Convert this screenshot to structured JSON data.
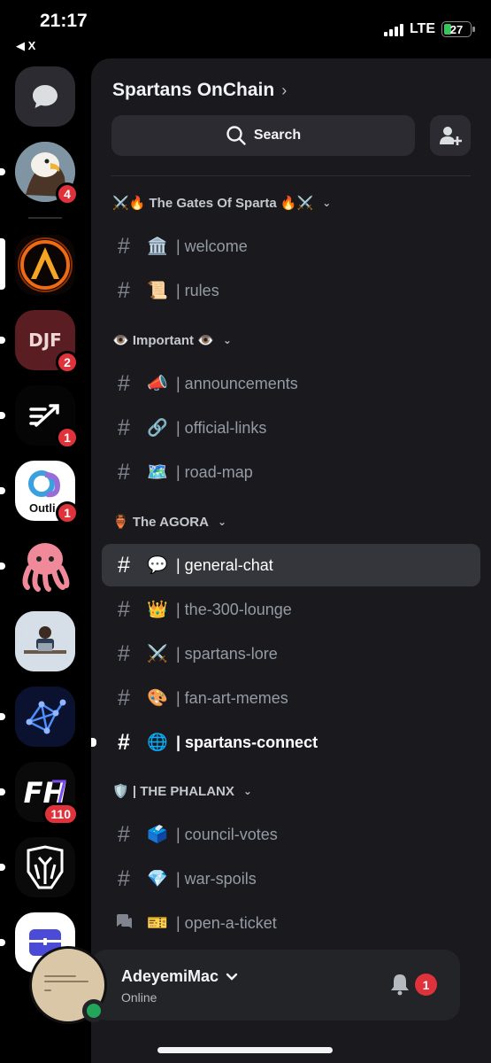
{
  "status_bar": {
    "time": "21:17",
    "back_label": "◀ X",
    "network": "LTE",
    "battery": "27",
    "battery_level": 0.27
  },
  "rail": {
    "servers": [
      {
        "name": "direct-messages",
        "badge": ""
      },
      {
        "name": "eagle-server",
        "badge": "4"
      },
      {
        "name": "fire-logo-server",
        "badge": ""
      },
      {
        "name": "djf-server",
        "badge": "2"
      },
      {
        "name": "arrow-logo-server",
        "badge": "1"
      },
      {
        "name": "outlier-server",
        "badge": "1",
        "label": "Outli"
      },
      {
        "name": "octopus-server",
        "badge": ""
      },
      {
        "name": "desk-avatar-server",
        "badge": ""
      },
      {
        "name": "network-logo-server",
        "badge": ""
      },
      {
        "name": "fh-server",
        "badge": "110"
      },
      {
        "name": "helmet-server",
        "badge": ""
      },
      {
        "name": "wallet-server",
        "badge": ""
      }
    ]
  },
  "server": {
    "name": "Spartans OnChain",
    "search_label": "Search"
  },
  "categories": [
    {
      "label": "⚔️🔥 The Gates Of Sparta 🔥⚔️"
    },
    {
      "label": "👁️ Important 👁️"
    },
    {
      "label": "🏺 The AGORA"
    },
    {
      "label": "🛡️ | THE PHALANX"
    }
  ],
  "channels": [
    {
      "emoji": "🏛️",
      "name": "| welcome"
    },
    {
      "emoji": "📜",
      "name": "| rules"
    },
    {
      "emoji": "📣",
      "name": "| announcements"
    },
    {
      "emoji": "🔗",
      "name": "| official-links"
    },
    {
      "emoji": "🗺️",
      "name": "| road-map"
    },
    {
      "emoji": "💬",
      "name": "| general-chat"
    },
    {
      "emoji": "👑",
      "name": "| the-300-lounge"
    },
    {
      "emoji": "⚔️",
      "name": "| spartans-lore"
    },
    {
      "emoji": "🎨",
      "name": "| fan-art-memes"
    },
    {
      "emoji": "🌐",
      "name": "| spartans-connect"
    },
    {
      "emoji": "🗳️",
      "name": "| council-votes"
    },
    {
      "emoji": "💎",
      "name": "| war-spoils"
    },
    {
      "emoji": "🎫",
      "name": "| open-a-ticket"
    }
  ],
  "user": {
    "name": "AdeyemiMac",
    "status": "Online",
    "notification_count": "1"
  },
  "colors": {
    "background": "#000000",
    "panel": "#1a1a1e",
    "active_channel": "#35363c",
    "badge": "#e0323b",
    "online": "#23a55a"
  }
}
